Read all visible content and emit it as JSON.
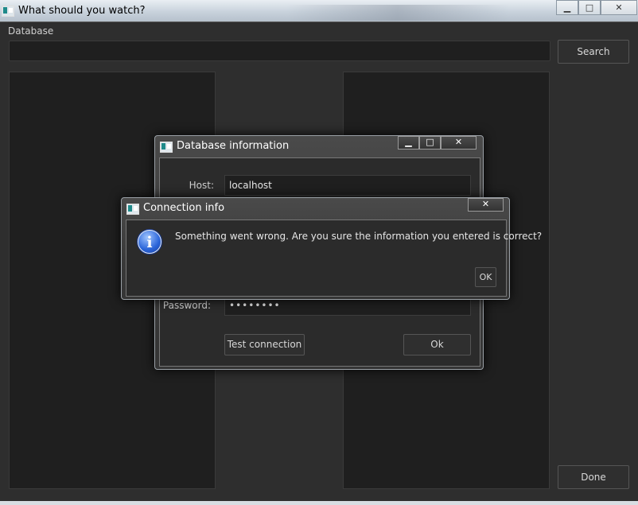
{
  "window": {
    "title": "What should you watch?",
    "minimize": "▁",
    "maximize": "□",
    "close": "✕"
  },
  "main": {
    "database_label": "Database",
    "search_value": "",
    "search_button": "Search",
    "done_button": "Done"
  },
  "db_dialog": {
    "title": "Database information",
    "minimize": "▁",
    "maximize": "□",
    "close": "✕",
    "host_label": "Host:",
    "host_value": "localhost",
    "password_label": "Password:",
    "password_value": "••••••••",
    "test_button": "Test connection",
    "ok_button": "Ok"
  },
  "conn_dialog": {
    "title": "Connection info",
    "close": "✕",
    "message": "Something went wrong. Are you sure the information you entered is correct?",
    "ok_button": "OK",
    "icon": "info-icon"
  }
}
